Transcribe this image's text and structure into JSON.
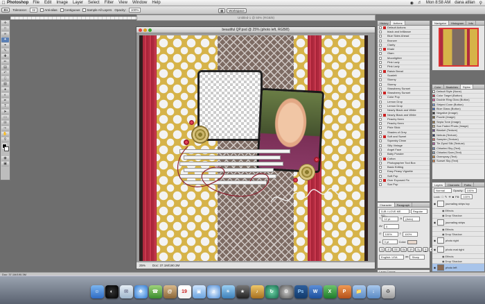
{
  "menubar": {
    "app": "Photoshop",
    "items": [
      "File",
      "Edit",
      "Image",
      "Layer",
      "Select",
      "Filter",
      "View",
      "Window",
      "Help"
    ],
    "clock": "Mon 8:58 AM",
    "user": "dana atllan"
  },
  "optionsbar": {
    "tolerance_label": "Tolerance:",
    "tolerance_value": "32",
    "anti_alias": "Anti-alias",
    "contiguous": "Contiguous",
    "sample_all_layers": "Sample All Layers",
    "opacity_label": "Opacity:",
    "opacity_value": "100%",
    "workspace": "Workspace"
  },
  "background_doc": {
    "title": "Untitled-1 @ 50% (RGB/8)"
  },
  "document": {
    "title": "beautiful QP.psd @ 25% (photo left, RGB/8)",
    "zoom": "25%",
    "doc_size": "Doc: 37.1M/190.3M"
  },
  "navigator": {
    "tabs": [
      "Navigator",
      "Histogram",
      "Info"
    ]
  },
  "history": {
    "tabs": [
      "History",
      "Actions"
    ]
  },
  "actions": [
    "Default Actions",
    "black and brilliance",
    "Blue Skies Ahead",
    "Bronzer",
    "Clarity",
    "Khaki",
    "Glam",
    "Moonlighter",
    "Pink Lady",
    "Pink Lady",
    "Raisin Bread",
    "Scarlett",
    "Stormy",
    "Stormy",
    "Strawberry Sunset",
    "Strawberry Sunset",
    "Color Pop",
    "Lemon Drop",
    "Lemon Drop",
    "Nearly Black and White",
    "Nearly Black and White",
    "Peachy Keen",
    "Peachy Keen",
    "Pixie Stick",
    "Shades of Grey",
    "Soft and Sweet",
    "Squeaky Clean",
    "Silly Vintage",
    "Angel Face",
    "Baby Powder",
    "Cotton",
    "Photographer Tool Box",
    "Basic Editing",
    "Easy Peasy Vignette",
    "Soft Pop",
    "Over Exposed Fix",
    "Sun Pop"
  ],
  "styles": {
    "tabs": [
      "Color",
      "Swatches",
      "Styles"
    ],
    "items": [
      "Default Style (None)",
      "Color Target (Button)",
      "Double Ring Glow (Button)",
      "Striped Cone (Button)",
      "Blue Glass (Button)",
      "Negative (Image)",
      "Puzzle (Image)",
      "Sepia Tone (Image)",
      "Sun Faded Photo (Image)",
      "Blanket (Texture)",
      "Nebula (Texture)",
      "Sampler (Texture)",
      "Tie-Dyed Silk (Texture)",
      "Chiseled Sky (Text)",
      "Chiseled Sam (Text)",
      "Overspray (Text)",
      "Sunset Sky (Text)"
    ]
  },
  "character": {
    "tabs": [
      "Character",
      "Paragraph"
    ],
    "font": "DJB I LOVE ME SO...",
    "style": "Regular",
    "size": "12 pt",
    "leading": "(Auto)",
    "tracking": "0",
    "vscale": "100%",
    "hscale": "100%",
    "baseline": "0 pt",
    "color_label": "Color:",
    "language": "English: USA",
    "aa": "Sharp"
  },
  "layers": {
    "tabs": [
      "Layers",
      "Channels",
      "Paths"
    ],
    "blend": "Normal",
    "opacity_label": "Opacity:",
    "opacity": "100%",
    "fill_label": "Fill:",
    "fill": "100%",
    "lock_label": "Lock:",
    "rows": [
      {
        "name": "journaling strips top",
        "kind": "layer"
      },
      {
        "name": "Effects",
        "kind": "sub"
      },
      {
        "name": "Drop Shadow",
        "kind": "sub"
      },
      {
        "name": "journaling strips",
        "kind": "layer"
      },
      {
        "name": "Effects",
        "kind": "sub"
      },
      {
        "name": "Drop Shadow",
        "kind": "sub"
      },
      {
        "name": "photo right",
        "kind": "layer"
      },
      {
        "name": "photo mat right",
        "kind": "layer"
      },
      {
        "name": "Effects",
        "kind": "sub"
      },
      {
        "name": "Drop Shadow",
        "kind": "sub"
      },
      {
        "name": "photo left",
        "kind": "layer",
        "selected": true
      }
    ]
  },
  "layer_comps": {
    "title": "Layer Comps"
  },
  "status": {
    "text": "Doc: 37.1M/190.3M"
  },
  "colors": {
    "gold": "#d6b349",
    "red": "#b02a3f",
    "selection": "#a8c4ea",
    "tool_selected": "#5a7fb5"
  },
  "dock": {
    "icons": [
      "finder-icon",
      "dashboard-icon",
      "mail-icon",
      "safari-icon",
      "ichat-icon",
      "address-book-icon",
      "ical-icon",
      "preview-icon",
      "itunes-icon",
      "iphoto-icon",
      "imovie-icon",
      "garageband-icon",
      "time-machine-icon",
      "system-preferences-icon",
      "photoshop-icon",
      "word-icon",
      "excel-icon",
      "powerpoint-icon",
      "folder-icon",
      "downloads-icon",
      "trash-icon"
    ],
    "ical_day": "19",
    "photoshop_label": "Ps"
  }
}
